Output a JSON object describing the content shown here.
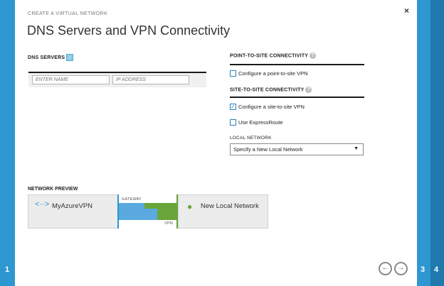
{
  "steps": {
    "left": "1",
    "right_a": "3",
    "right_b": "4"
  },
  "dialog": {
    "kicker": "CREATE A VIRTUAL NETWORK",
    "title": "DNS Servers and VPN Connectivity",
    "close_glyph": "×"
  },
  "dns": {
    "label": "DNS SERVERS",
    "name_placeholder": "ENTER NAME",
    "ip_placeholder": "IP ADDRESS"
  },
  "p2s": {
    "label": "POINT-TO-SITE CONNECTIVITY",
    "checkbox_label": "Configure a point-to-site VPN",
    "checked": false
  },
  "s2s": {
    "label": "SITE-TO-SITE CONNECTIVITY",
    "checkbox_label": "Configure a site-to-site VPN",
    "checked": true,
    "expressroute_label": "Use ExpressRoute",
    "expressroute_checked": false
  },
  "local_network": {
    "label": "LOCAL NETWORK",
    "selected": "Specify a New Local Network"
  },
  "preview": {
    "label": "NETWORK PREVIEW",
    "vnet_name": "MyAzureVPN",
    "gateway_label": "GATEWAY",
    "vpn_label": "VPN",
    "local_name": "New Local Network"
  },
  "nav": {
    "back_glyph": "←",
    "next_glyph": "→"
  },
  "colors": {
    "accent": "#2e97d2",
    "vpn_green": "#6aa53a",
    "gateway_blue": "#5aa9df"
  }
}
